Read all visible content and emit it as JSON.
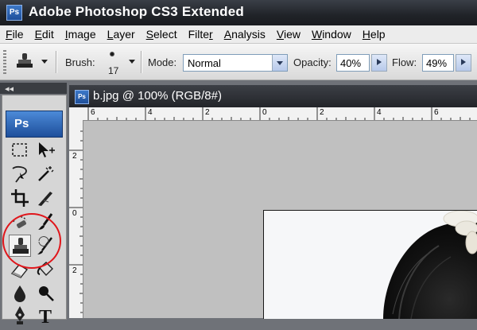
{
  "window": {
    "title": "Adobe Photoshop CS3 Extended",
    "app_icon": "Ps"
  },
  "menu": [
    {
      "pre": "",
      "u": "F",
      "post": "ile"
    },
    {
      "pre": "",
      "u": "E",
      "post": "dit"
    },
    {
      "pre": "",
      "u": "I",
      "post": "mage"
    },
    {
      "pre": "",
      "u": "L",
      "post": "ayer"
    },
    {
      "pre": "",
      "u": "S",
      "post": "elect"
    },
    {
      "pre": "Filte",
      "u": "r",
      "post": ""
    },
    {
      "pre": "",
      "u": "A",
      "post": "nalysis"
    },
    {
      "pre": "",
      "u": "V",
      "post": "iew"
    },
    {
      "pre": "",
      "u": "W",
      "post": "indow"
    },
    {
      "pre": "",
      "u": "H",
      "post": "elp"
    }
  ],
  "options": {
    "brush_label": "Brush:",
    "brush_size": "17",
    "mode_label": "Mode:",
    "mode_value": "Normal",
    "opacity_label": "Opacity:",
    "opacity_value": "40%",
    "flow_label": "Flow:",
    "flow_value": "49%"
  },
  "toolbox": {
    "logo": "Ps",
    "collapse_glyph": "◂◂"
  },
  "document": {
    "title": "b.jpg @ 100% (RGB/8#)",
    "icon": "Ps",
    "ruler_h": [
      "6",
      "4",
      "2",
      "0",
      "2",
      "4",
      "6"
    ],
    "ruler_v": [
      "2",
      "0",
      "2"
    ]
  },
  "colors": {
    "highlight": "#e0161b",
    "titlebar": "#202328",
    "canvas": "#c0c0c0"
  }
}
